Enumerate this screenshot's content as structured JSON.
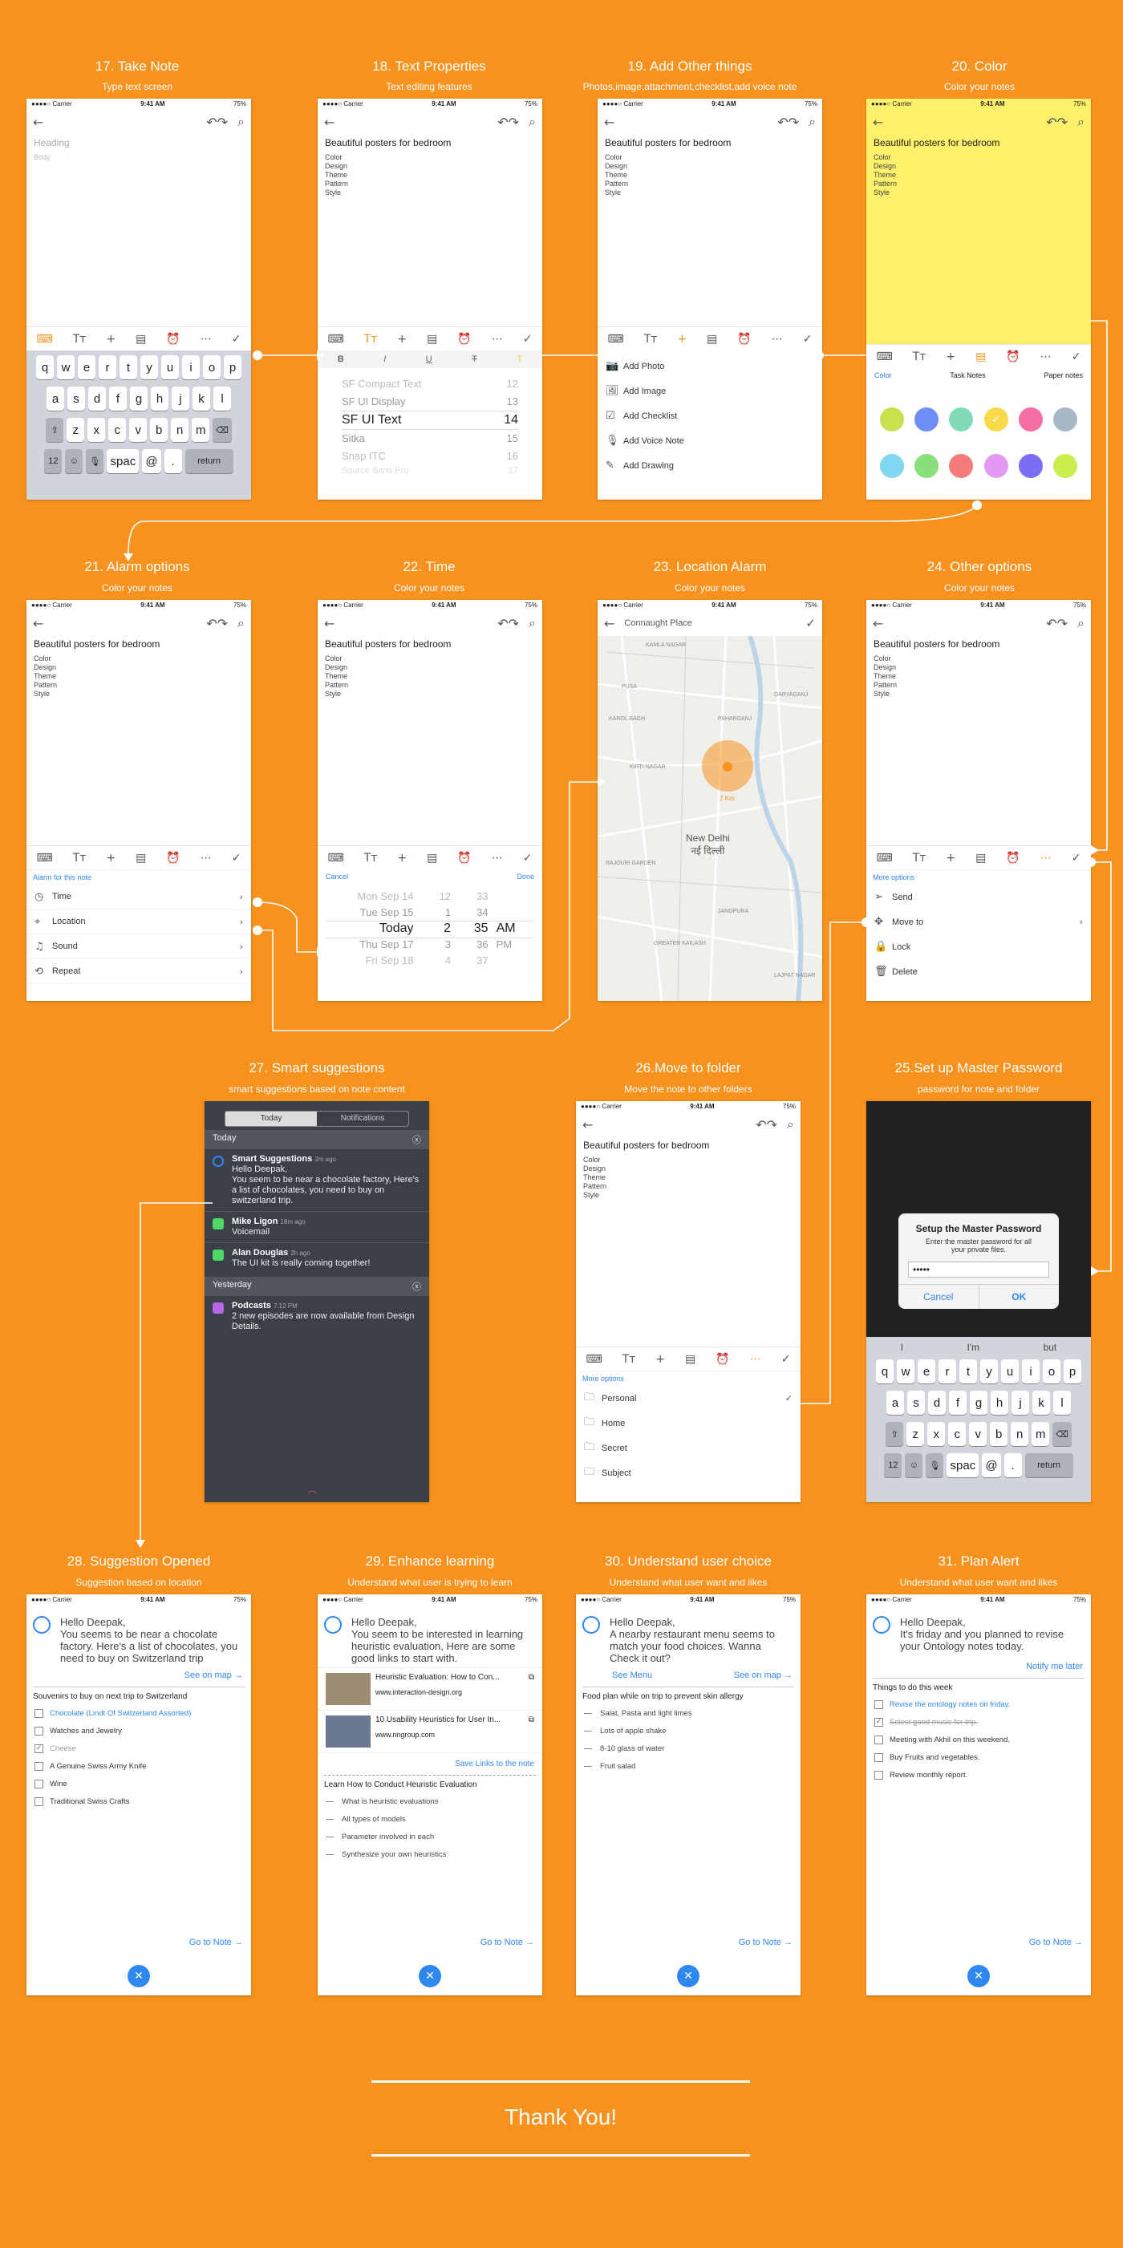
{
  "colors": {
    "accent": "#f8921e",
    "blue": "#2e88f0",
    "note_yellow": "#fdf06a"
  },
  "status": {
    "carrier": "●●●●○ Carrier",
    "time": "9:41 AM",
    "battery": "75%"
  },
  "common": {
    "note_title": "Beautiful posters for bedroom",
    "note_lines": [
      "Color",
      "Design",
      "Theme",
      "Pattern",
      "Style"
    ]
  },
  "screens": {
    "s17": {
      "title": "17. Take Note",
      "subtitle": "Type text screen",
      "heading_ph": "Heading",
      "body_ph": "Body"
    },
    "s18": {
      "title": "18. Text Properties",
      "subtitle": "Text editing features",
      "fonts": [
        "SF Compact Text",
        "SF UI Display",
        "SF UI Text",
        "Sitka",
        "Snap ITC",
        "Source Sans Pro"
      ],
      "sizes": [
        "12",
        "13",
        "14",
        "15",
        "16",
        "17"
      ]
    },
    "s19": {
      "title": "19. Add Other things",
      "subtitle": "Photos,image,attachment,checklist,add voice note",
      "items": [
        "Add Photo",
        "Add Image",
        "Add Checklist",
        "Add Voice Note",
        "Add Drawing"
      ]
    },
    "s20": {
      "title": "20. Color",
      "subtitle": "Color your notes",
      "tabs": [
        "Color",
        "Task Notes",
        "Paper notes"
      ],
      "swatches": [
        "#c9e14f",
        "#6f8ef5",
        "#80dcb6",
        "#f7d94a",
        "#f56ea3",
        "#a8b8c8",
        "#7fd8ef",
        "#87e07a",
        "#f57a7a",
        "#e39af2",
        "#7a6ef5",
        "#c9ef4f"
      ]
    },
    "s21": {
      "title": "21. Alarm options",
      "subtitle": "Color your notes",
      "label": "Alarm for this note",
      "items": [
        "Time",
        "Location",
        "Sound",
        "Repeat"
      ]
    },
    "s22": {
      "title": "22. Time",
      "subtitle": "Color your notes",
      "cancel": "Cancel",
      "done": "Done",
      "days": [
        "Mon Sep 14",
        "Tue Sep 15",
        "Today",
        "Thu Sep 17",
        "Fri Sep 18"
      ],
      "hours": [
        "12",
        "1",
        "2",
        "3",
        "4"
      ],
      "mins": [
        "33",
        "34",
        "35",
        "36",
        "37"
      ],
      "ampm": [
        "AM",
        "PM"
      ]
    },
    "s23": {
      "title": "23. Location Alarm",
      "subtitle": "Color your notes",
      "place": "Connaught Place",
      "city": "New Delhi",
      "city_hi": "नई दिल्ली",
      "radius": "2 Km",
      "areas": [
        "KAMLA NAGAR",
        "KAROL BAGH",
        "PAHARGANJ",
        "JANGPURA",
        "LAJPAT NAGAR",
        "DARYAGANJ",
        "KIRTI NAGAR",
        "RAJOURI GARDEN",
        "PUSA",
        "GREATER KAILASH"
      ]
    },
    "s24": {
      "title": "24. Other options",
      "subtitle": "Color your notes",
      "label": "More options",
      "items": [
        "Send",
        "Move to",
        "Lock",
        "Delete"
      ]
    },
    "s25": {
      "title": "25.Set up Master Password",
      "subtitle": "password for note and folder",
      "dialog_title": "Setup the Master Password",
      "dialog_msg": "Enter the master password for all your private files.",
      "password": "•••••",
      "cancel": "Cancel",
      "ok": "OK",
      "suggest": [
        "I",
        "I'm",
        "but"
      ]
    },
    "s26": {
      "title": "26.Move to folder",
      "subtitle": "Move the note to other folders",
      "label": "More options",
      "folders": [
        "Personal",
        "Home",
        "Secret",
        "Subject"
      ]
    },
    "s27": {
      "title": "27. Smart suggestions",
      "subtitle": "smart suggestions based on note content",
      "tabs": [
        "Today",
        "Notifications"
      ],
      "today": "Today",
      "yesterday": "Yesterday",
      "notes": [
        {
          "app": "Smart Suggestions",
          "time": "2m ago",
          "text": "Hello Deepak,\nYou seem to be near a chocolate factory, Here's a list of chocolates, you need to buy on switzerland trip.",
          "color": "#2e88f0"
        },
        {
          "app": "Mike Ligon",
          "time": "18m ago",
          "text": "Voicemail",
          "color": "#4cd964"
        },
        {
          "app": "Alan Douglas",
          "time": "2h ago",
          "text": "The UI kit is really coming together!",
          "color": "#4cd964"
        },
        {
          "app": "Podcasts",
          "time": "7:12 PM",
          "text": "2 new episodes are now available from Design Details.",
          "color": "#b565e6"
        }
      ]
    },
    "s28": {
      "title": "28. Suggestion Opened",
      "subtitle": "Suggestion based on location",
      "greeting": "Hello Deepak,",
      "message": "You seems to be near a chocolate factory. Here's a list of chocolates, you need to buy on Switzerland trip",
      "see_map": "See on map",
      "list_title": "Souvenirs to buy on next trip to Switzerland",
      "items": [
        "Chocolate (Lindt Of Switzerland Assorted)",
        "Watches and Jewelry",
        "Cheese",
        "A Genuine Swiss Army Knife",
        "Wine",
        "Traditional Swiss Crafts"
      ],
      "goto": "Go to Note"
    },
    "s29": {
      "title": "29. Enhance learning",
      "subtitle": "Understand what user is trying to learn",
      "greeting": "Hello Deepak,",
      "message": "You seem to be interested in learning heuristic evaluation, Here are some good links to start with.",
      "links": [
        {
          "title": "Heuristic Evaluation: How to Con...",
          "url": "www.interaction-design.org"
        },
        {
          "title": "10 Usability Heuristics for User In...",
          "url": "www.nngroup.com"
        }
      ],
      "save": "Save Links to the note",
      "list_title": "Learn How to Conduct Heuristic Evaluation",
      "items": [
        "What is heuristic evaluations",
        "All types of models",
        "Parameter involved in each",
        "Synthesize your own heuristics"
      ],
      "goto": "Go to Note"
    },
    "s30": {
      "title": "30. Understand user choice",
      "subtitle": "Understand what user want and likes",
      "greeting": "Hello Deepak,",
      "message": "A nearby restaurant menu seems to match your food choices. Wanna Check it out?",
      "see_menu": "See Menu",
      "see_map": "See on map",
      "list_title": "Food plan while on trip to prevent skin allergy",
      "items": [
        "Salat, Pasta and light limes",
        "Lots of apple shake",
        "8-10 glass of water",
        "Fruit salad"
      ],
      "goto": "Go to Note"
    },
    "s31": {
      "title": "31. Plan Alert",
      "subtitle": "Understand what user want and likes",
      "greeting": "Hello Deepak,",
      "message": "It's friday and you planned to revise your Ontology notes today.",
      "notify": "Notify me later",
      "list_title": "Things to do this week",
      "items": [
        "Revise the ontology notes on friday.",
        "Select good music for trip.",
        "Meeting with Akhil on this weekend.",
        "Buy Fruits and vegetables.",
        "Review monthly report."
      ],
      "goto": "Go to Note"
    }
  },
  "keyboard": {
    "row1": [
      "q",
      "w",
      "e",
      "r",
      "t",
      "y",
      "u",
      "i",
      "o",
      "p"
    ],
    "row2": [
      "a",
      "s",
      "d",
      "f",
      "g",
      "h",
      "j",
      "k",
      "l"
    ],
    "row3": [
      "z",
      "x",
      "c",
      "v",
      "b",
      "n",
      "m"
    ],
    "num": "12",
    "space": "spac",
    "at": "@",
    "dot": ".",
    "ret": "return"
  },
  "format": [
    "B",
    "I",
    "U",
    "T",
    "T"
  ],
  "thanks": "Thank You!"
}
